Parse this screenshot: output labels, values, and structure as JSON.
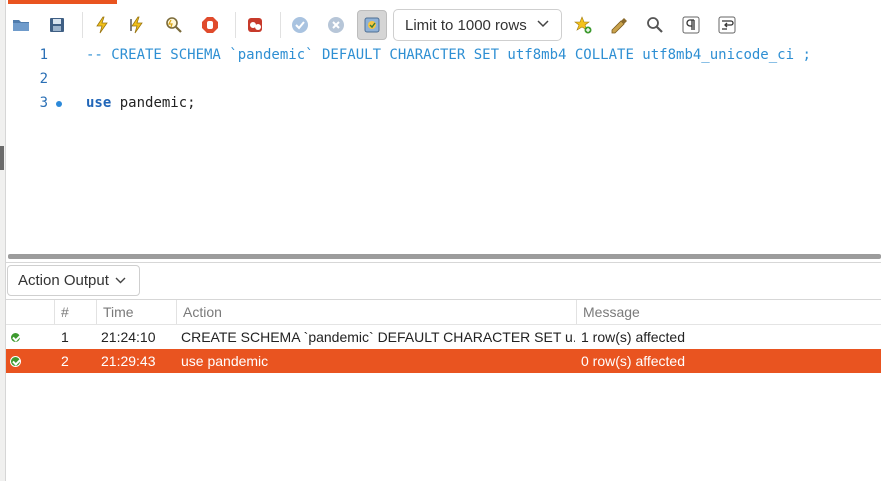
{
  "toolbar": {
    "limit_label": "Limit to 1000 rows",
    "icons": [
      "open-folder-icon",
      "save-icon",
      "execute-icon",
      "execute-current-icon",
      "explain-icon",
      "stop-icon",
      "toggle-error-icon",
      "commit-icon",
      "rollback-icon",
      "autocommit-icon",
      "add-snippet-icon",
      "beautify-icon",
      "find-icon",
      "invisible-chars-icon",
      "wrap-icon"
    ]
  },
  "editor": {
    "lines": [
      {
        "num": "1",
        "text": "-- CREATE SCHEMA `pandemic` DEFAULT CHARACTER SET utf8mb4 COLLATE utf8mb4_unicode_ci ;"
      },
      {
        "num": "2",
        "text": ""
      },
      {
        "num": "3",
        "keyword": "use",
        "text": " pandemic;"
      }
    ]
  },
  "output": {
    "selector_label": "Action Output",
    "columns": [
      "#",
      "Time",
      "Action",
      "Message"
    ],
    "rows": [
      {
        "num": "1",
        "time": "21:24:10",
        "action": "CREATE SCHEMA `pandemic` DEFAULT CHARACTER SET u...",
        "message": "1 row(s) affected",
        "status": "success"
      },
      {
        "num": "2",
        "time": "21:29:43",
        "action": "use pandemic",
        "message": "0 row(s) affected",
        "status": "success"
      }
    ]
  },
  "colors": {
    "accent": "#e95420",
    "keyword": "#2166b8",
    "comment": "#2e8fd3",
    "success": "#3d9a2f"
  }
}
